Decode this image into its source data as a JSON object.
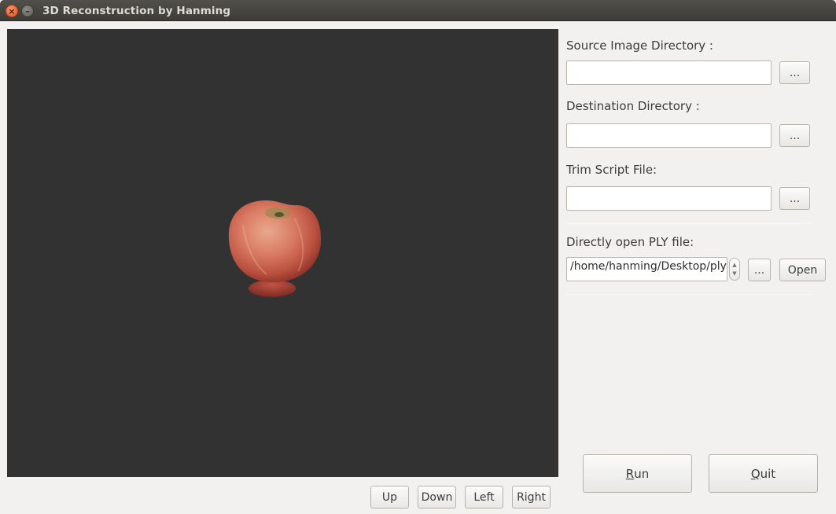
{
  "window": {
    "title": "3D Reconstruction by Hanming",
    "close_glyph": "×",
    "minimize_glyph": "–"
  },
  "viewport": {
    "background": "#323232",
    "object": "apple-3d-model"
  },
  "nav_buttons": {
    "up": "Up",
    "down": "Down",
    "left": "Left",
    "right": "Right"
  },
  "form": {
    "source_label": "Source Image Directory :",
    "source_value": "",
    "destination_label": "Destination Directory :",
    "destination_value": "",
    "trim_label": "Trim Script File:",
    "trim_value": "",
    "browse_label": "...",
    "ply_label": "Directly open PLY file:",
    "ply_value": "/home/hanming/Desktop/plySample/Apple_ascii.ply",
    "open_label": "Open"
  },
  "actions": {
    "run_mnemonic": "R",
    "run_rest": "un",
    "quit_mnemonic": "Q",
    "quit_rest": "uit"
  }
}
